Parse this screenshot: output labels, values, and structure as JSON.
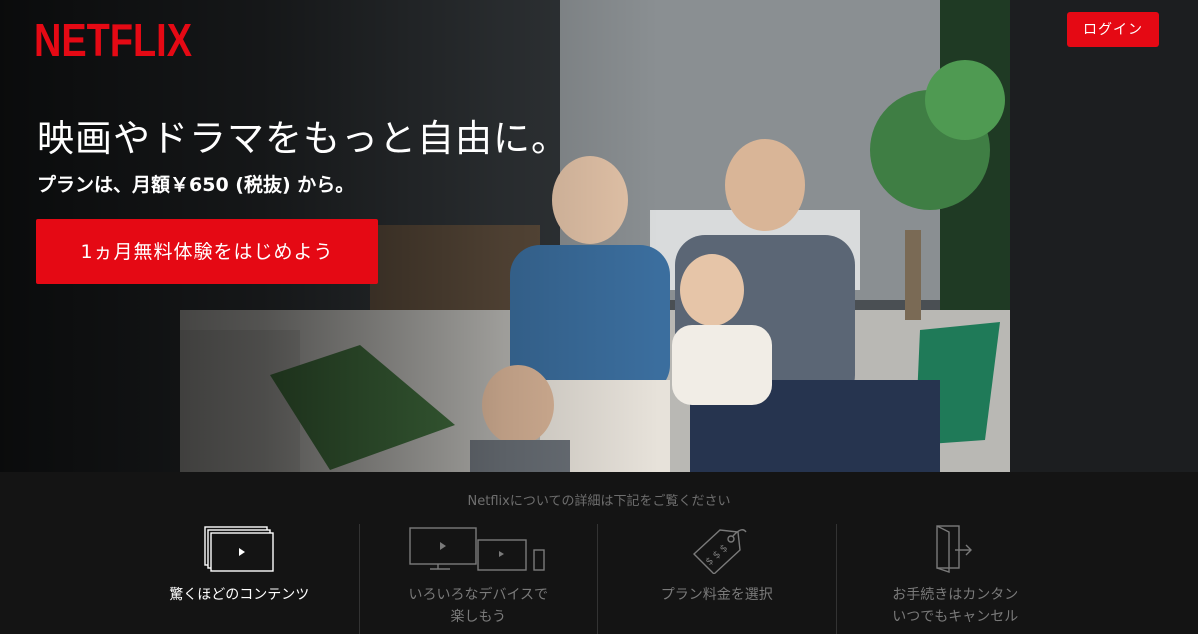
{
  "brand": {
    "logo_text": "NETFLIX",
    "accent": "#e50914"
  },
  "header": {
    "login_label": "ログイン"
  },
  "hero": {
    "headline": "映画やドラマをもっと自由に。",
    "subline": "プランは、月額￥650 (税抜) から。",
    "cta_label": "1ヵ月無料体験をはじめよう"
  },
  "features": {
    "intro": "Netflixについての詳細は下記をご覧ください",
    "tabs": [
      {
        "icon": "stacked-screens-play-icon",
        "lines": [
          "驚くほどのコンテンツ"
        ],
        "active": true
      },
      {
        "icon": "devices-icon",
        "lines": [
          "いろいろなデバイスで",
          "楽しもう"
        ],
        "active": false
      },
      {
        "icon": "price-tag-icon",
        "lines": [
          "プラン料金を選択"
        ],
        "active": false
      },
      {
        "icon": "exit-door-icon",
        "lines": [
          "お手続きはカンタン",
          "いつでもキャンセル"
        ],
        "active": false
      }
    ]
  }
}
